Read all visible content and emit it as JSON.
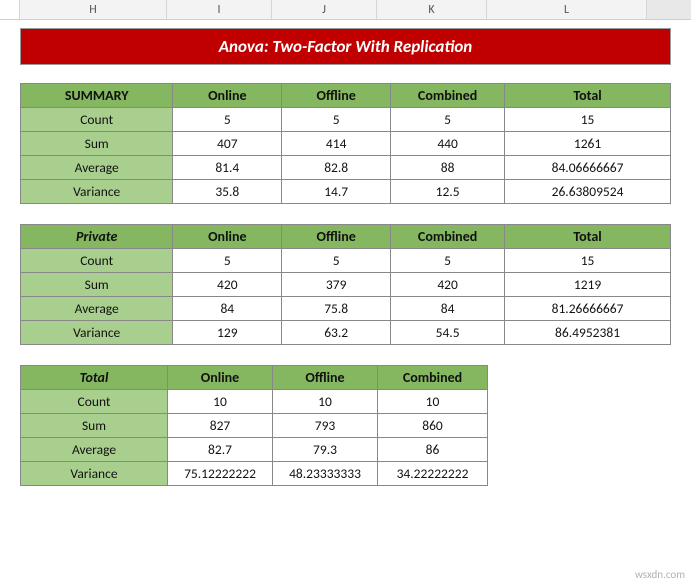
{
  "columns": {
    "H": "H",
    "I": "I",
    "J": "J",
    "K": "K",
    "L": "L"
  },
  "title": "Anova: Two-Factor With Replication",
  "headers": {
    "online": "Online",
    "offline": "Offline",
    "combined": "Combined",
    "total": "Total"
  },
  "row_labels": {
    "count": "Count",
    "sum": "Sum",
    "average": "Average",
    "variance": "Variance"
  },
  "tables": {
    "summary": {
      "label": "SUMMARY",
      "count": {
        "online": "5",
        "offline": "5",
        "combined": "5",
        "total": "15"
      },
      "sum": {
        "online": "407",
        "offline": "414",
        "combined": "440",
        "total": "1261"
      },
      "average": {
        "online": "81.4",
        "offline": "82.8",
        "combined": "88",
        "total": "84.06666667"
      },
      "variance": {
        "online": "35.8",
        "offline": "14.7",
        "combined": "12.5",
        "total": "26.63809524"
      }
    },
    "private": {
      "label": "Private",
      "count": {
        "online": "5",
        "offline": "5",
        "combined": "5",
        "total": "15"
      },
      "sum": {
        "online": "420",
        "offline": "379",
        "combined": "420",
        "total": "1219"
      },
      "average": {
        "online": "84",
        "offline": "75.8",
        "combined": "84",
        "total": "81.26666667"
      },
      "variance": {
        "online": "129",
        "offline": "63.2",
        "combined": "54.5",
        "total": "86.4952381"
      }
    },
    "total": {
      "label": "Total",
      "count": {
        "online": "10",
        "offline": "10",
        "combined": "10"
      },
      "sum": {
        "online": "827",
        "offline": "793",
        "combined": "860"
      },
      "average": {
        "online": "82.7",
        "offline": "79.3",
        "combined": "86"
      },
      "variance": {
        "online": "75.12222222",
        "offline": "48.23333333",
        "combined": "34.22222222"
      }
    }
  },
  "watermark": "wsxdn.com",
  "chart_data": [
    {
      "type": "table",
      "title": "SUMMARY",
      "columns": [
        "Online",
        "Offline",
        "Combined",
        "Total"
      ],
      "rows": [
        "Count",
        "Sum",
        "Average",
        "Variance"
      ],
      "values": [
        [
          5,
          5,
          5,
          15
        ],
        [
          407,
          414,
          440,
          1261
        ],
        [
          81.4,
          82.8,
          88,
          84.06666667
        ],
        [
          35.8,
          14.7,
          12.5,
          26.63809524
        ]
      ]
    },
    {
      "type": "table",
      "title": "Private",
      "columns": [
        "Online",
        "Offline",
        "Combined",
        "Total"
      ],
      "rows": [
        "Count",
        "Sum",
        "Average",
        "Variance"
      ],
      "values": [
        [
          5,
          5,
          5,
          15
        ],
        [
          420,
          379,
          420,
          1219
        ],
        [
          84,
          75.8,
          84,
          81.26666667
        ],
        [
          129,
          63.2,
          54.5,
          86.4952381
        ]
      ]
    },
    {
      "type": "table",
      "title": "Total",
      "columns": [
        "Online",
        "Offline",
        "Combined"
      ],
      "rows": [
        "Count",
        "Sum",
        "Average",
        "Variance"
      ],
      "values": [
        [
          10,
          10,
          10
        ],
        [
          827,
          793,
          860
        ],
        [
          82.7,
          79.3,
          86
        ],
        [
          75.12222222,
          48.23333333,
          34.22222222
        ]
      ]
    }
  ]
}
